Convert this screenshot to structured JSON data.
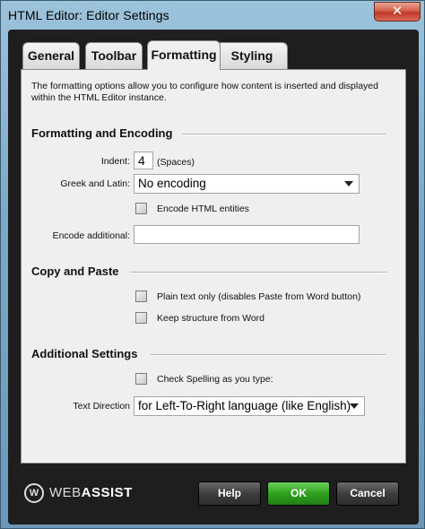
{
  "window": {
    "title": "HTML Editor: Editor Settings",
    "close_glyph": "✕"
  },
  "tabs": [
    {
      "label": "General"
    },
    {
      "label": "Toolbar"
    },
    {
      "label": "Formatting"
    },
    {
      "label": "Styling"
    }
  ],
  "active_tab": "Formatting",
  "description": "The formatting options allow you to configure how content is inserted and displayed within the HTML Editor instance.",
  "formatting_encoding": {
    "heading": "Formatting and Encoding",
    "indent_label": "Indent:",
    "indent_value": "4",
    "indent_unit": "(Spaces)",
    "greek_label": "Greek and Latin:",
    "greek_value": "No encoding",
    "encode_entities_label": "Encode HTML entities",
    "encode_entities_checked": false,
    "encode_additional_label": "Encode additional:",
    "encode_additional_value": ""
  },
  "copy_paste": {
    "heading": "Copy and Paste",
    "plain_text_label": "Plain text only (disables Paste from Word button)",
    "plain_text_checked": false,
    "keep_structure_label": "Keep structure from Word",
    "keep_structure_checked": false
  },
  "additional": {
    "heading": "Additional Settings",
    "spelling_label": "Check Spelling as you type:",
    "spelling_checked": false,
    "direction_label": "Text Direction",
    "direction_value": "for Left-To-Right language (like English)"
  },
  "footer": {
    "logo_mark": "W",
    "logo_text_a": "WEB",
    "logo_text_b": "ASSIST",
    "help_label": "Help",
    "ok_label": "OK",
    "cancel_label": "Cancel"
  },
  "colors": {
    "ok_button": "#2ea11e",
    "frame": "#1e1e1e",
    "panel": "#efefef",
    "close_button": "#c0392b"
  }
}
